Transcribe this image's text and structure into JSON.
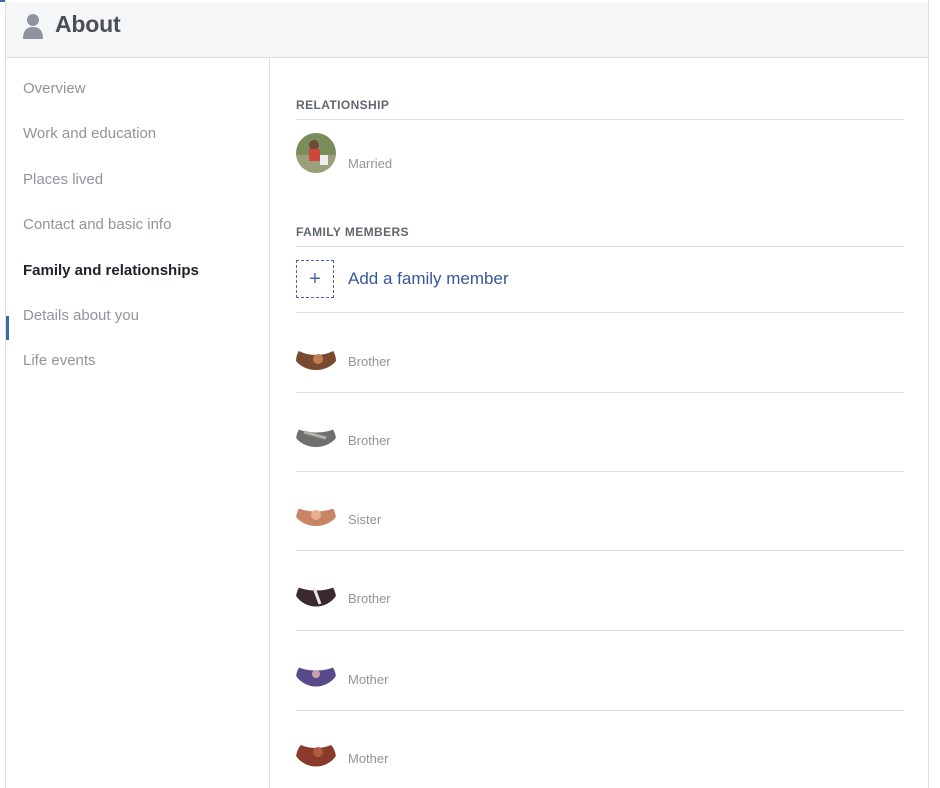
{
  "header": {
    "title": "About",
    "icon": "person-silhouette-icon"
  },
  "sidebar": {
    "items": [
      {
        "label": "Overview"
      },
      {
        "label": "Work and education"
      },
      {
        "label": "Places lived"
      },
      {
        "label": "Contact and basic info"
      },
      {
        "label": "Family and relationships"
      },
      {
        "label": "Details about you"
      },
      {
        "label": "Life events"
      }
    ],
    "active_index": 4
  },
  "relationship": {
    "title": "RELATIONSHIP",
    "status": "Married"
  },
  "family": {
    "title": "FAMILY MEMBERS",
    "add_label": "Add a family member",
    "add_icon": "+",
    "members": [
      {
        "relation": "Brother"
      },
      {
        "relation": "Brother"
      },
      {
        "relation": "Sister"
      },
      {
        "relation": "Brother"
      },
      {
        "relation": "Mother"
      },
      {
        "relation": "Mother"
      }
    ]
  },
  "colors": {
    "accent": "#4267b2",
    "link": "#365899",
    "muted_text": "#90949c",
    "header_bg": "#f5f6f7"
  }
}
